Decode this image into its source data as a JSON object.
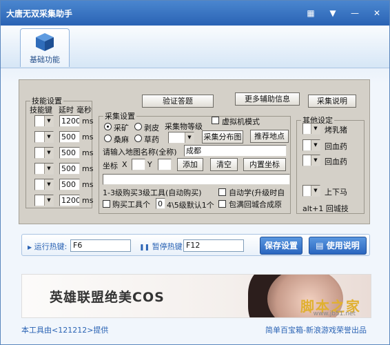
{
  "window": {
    "title": "大唐无双采集助手"
  },
  "toolbar": {
    "tool_label": "基础功能"
  },
  "header_buttons": {
    "verify": "验证答题",
    "more": "更多辅助信息",
    "collect_help": "采集说明"
  },
  "skills": {
    "legend": "技能设置",
    "col_key": "技能键",
    "col_delay": "延时",
    "col_unit": "毫秒",
    "rows": [
      {
        "delay": "1200",
        "unit": "ms"
      },
      {
        "delay": "500",
        "unit": "ms"
      },
      {
        "delay": "500",
        "unit": "ms"
      },
      {
        "delay": "500",
        "unit": "ms"
      },
      {
        "delay": "500",
        "unit": "ms"
      },
      {
        "delay": "1200",
        "unit": "ms"
      }
    ]
  },
  "collect": {
    "legend": "采集设置",
    "virtual": "虚拟机模式",
    "types": [
      "采矿",
      "剥皮",
      "桑麻",
      "草药"
    ],
    "level_label": "采集物等级",
    "dist_btn": "采集分布图",
    "recommend_btn": "推荐地点",
    "map_prompt": "请输入地图名称(全称)",
    "map_value": "成都",
    "coord_label": "坐标",
    "x_label": "X",
    "y_label": "Y",
    "add_btn": "添加",
    "clear_btn": "清空",
    "builtin_btn": "内置坐标",
    "coord_list_value": "",
    "buy_note": "1-3级购买3级工具(自动购买)",
    "auto_learn": "自动学(升级时自",
    "buy_tools_label": "购买工具个",
    "buy_tools_value": "0",
    "buy_tools_hint": "4\\5级默认1个",
    "bag_full": "包满回城合成原"
  },
  "other": {
    "legend": "其他设定",
    "items": [
      "烤乳猪",
      "回血药",
      "回血药"
    ],
    "mount": "上下马",
    "alt_note": "alt+1  回城技"
  },
  "hotkeys": {
    "run_label": "运行热键:",
    "run_value": "F6",
    "pause_label": "暂停热键:",
    "pause_value": "F12",
    "save_btn": "保存设置",
    "help_btn": "使用说明"
  },
  "banner": {
    "text": "英雄联盟绝美COS",
    "watermark": "脚本之家",
    "watermark_url": "www.jb51.net"
  },
  "footer": {
    "left": "本工具由<121212>提供",
    "right": "简单百宝箱-新浪游戏荣誉出品"
  }
}
